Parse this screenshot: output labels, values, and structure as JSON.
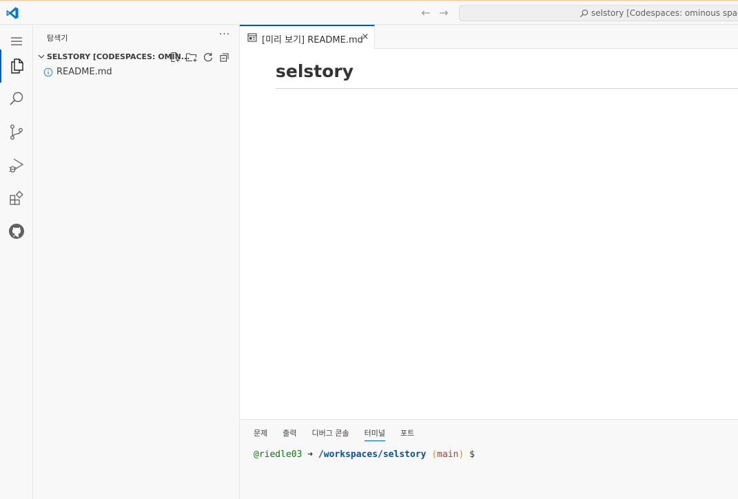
{
  "titlebar": {
    "search_text": "selstory [Codespaces: ominous space engine]",
    "back_icon": "arrow-left-icon",
    "forward_icon": "arrow-right-icon"
  },
  "activitybar": {
    "items": [
      "explorer-icon",
      "search-icon",
      "source-control-icon",
      "run-debug-icon",
      "extensions-icon",
      "github-icon"
    ],
    "active": "explorer-icon"
  },
  "sidebar": {
    "title": "탐색기",
    "more": "···",
    "folder_name": "SELSTORY [CODESPACES: OMIN...",
    "files": [
      {
        "name": "README.md",
        "icon": "info-icon"
      }
    ]
  },
  "editor": {
    "tab_label": "[미리 보기] README.md",
    "tab_close": "×",
    "heading": "selstory"
  },
  "panel": {
    "tabs": [
      "문제",
      "출력",
      "디버그 콘솔",
      "터미널",
      "포트"
    ],
    "active_tab": "터미널",
    "terminal": {
      "user": "@riedle03",
      "arrow": "➜",
      "path": "/workspaces/selstory",
      "paren_open": "(",
      "branch": "main",
      "paren_close": ")",
      "prompt": "$"
    }
  },
  "colors": {
    "accent": "#005fb8",
    "vscode_blue": "#007acc"
  }
}
